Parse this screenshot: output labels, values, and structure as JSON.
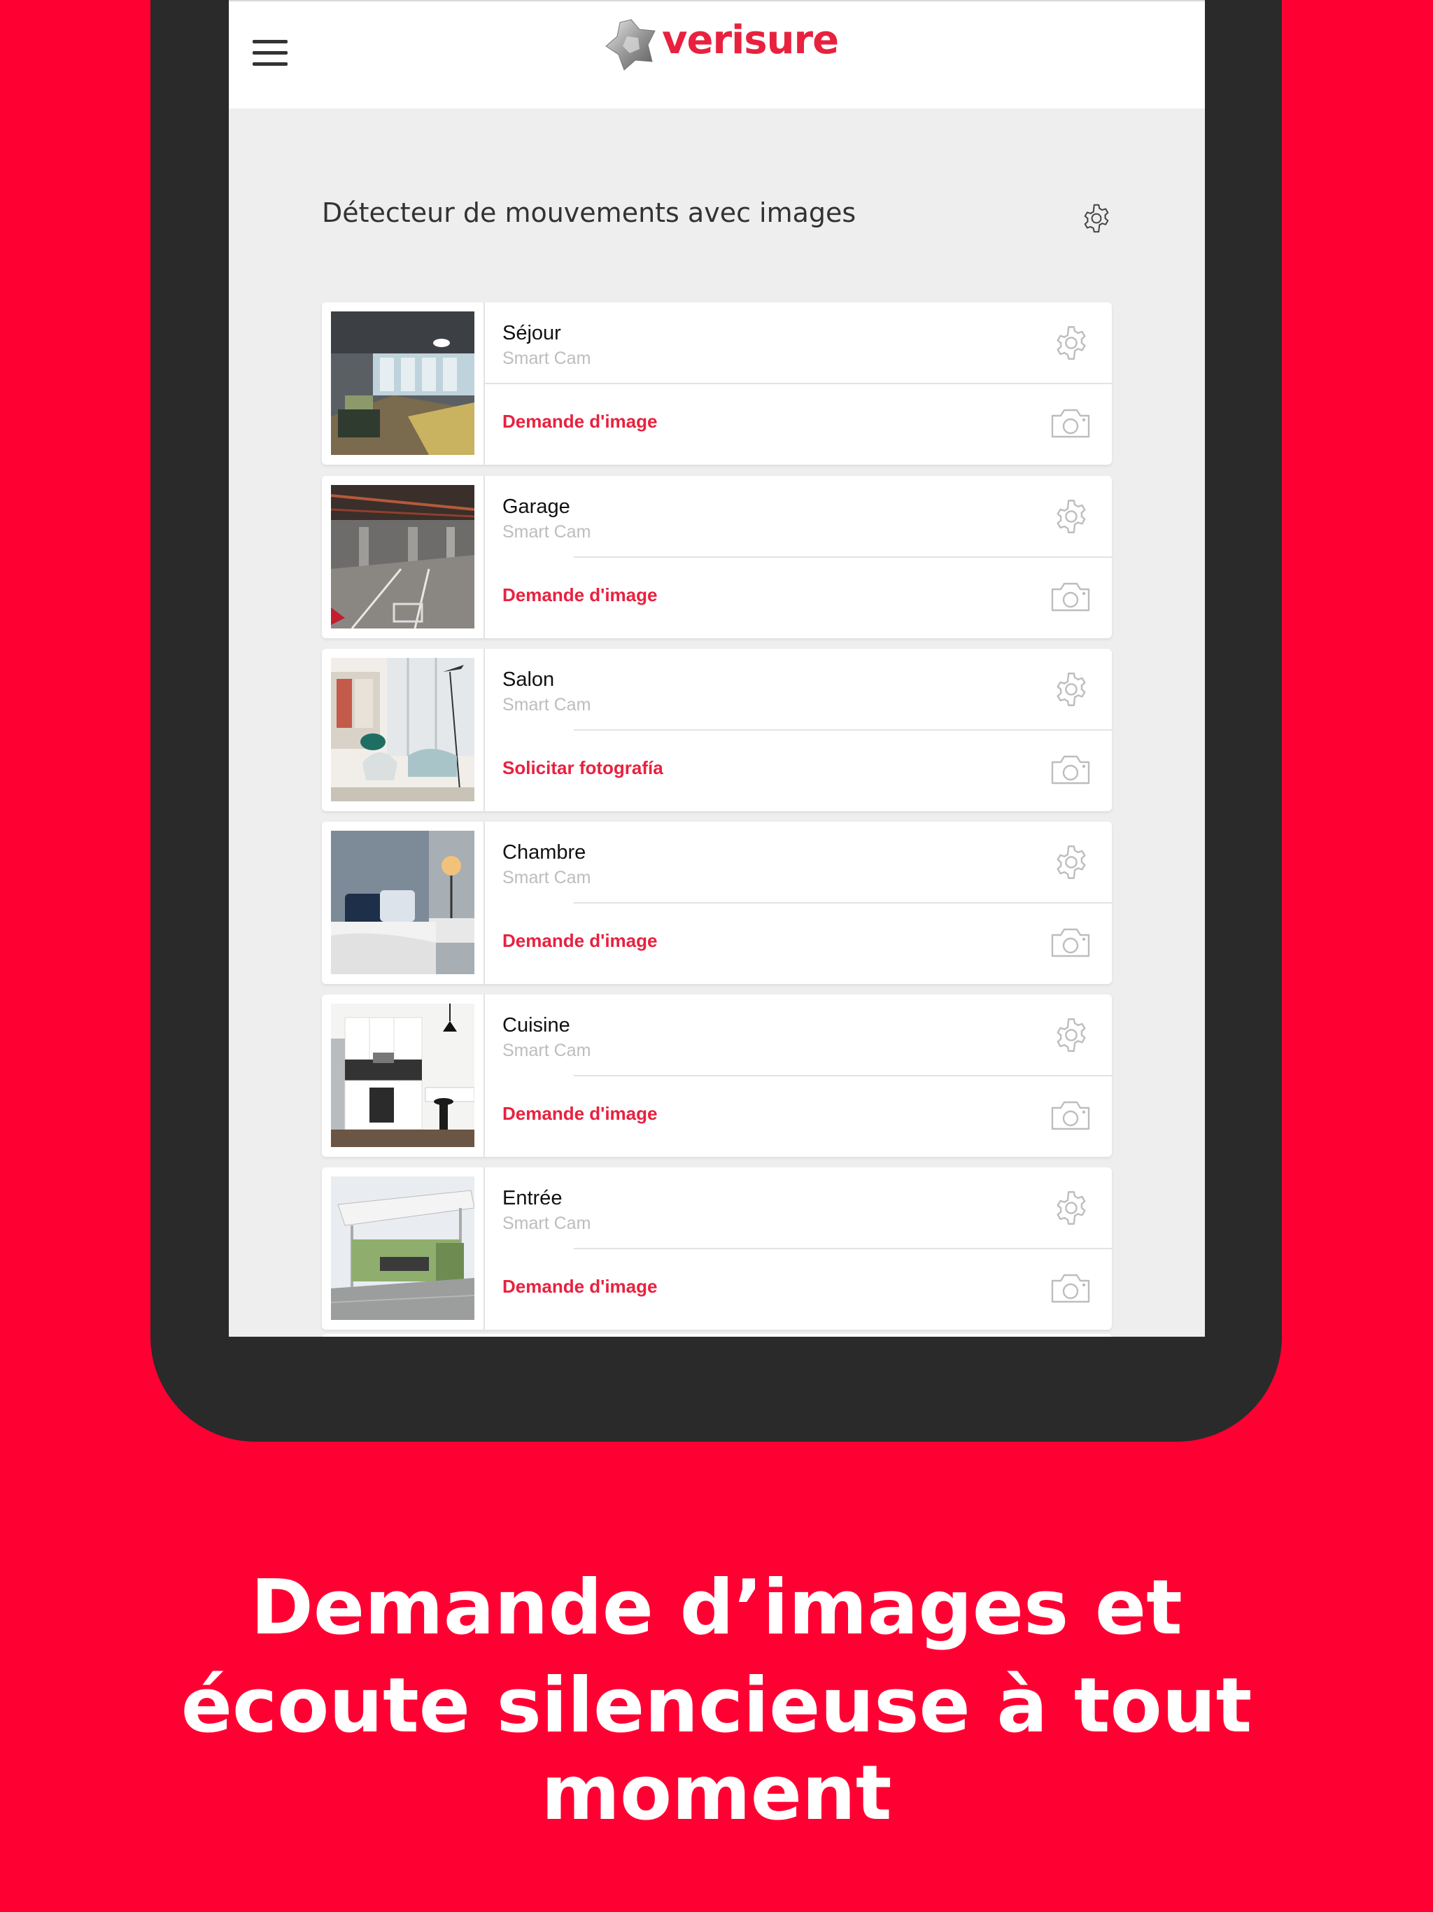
{
  "app": {
    "logo_text": "verisure",
    "brand_color": "#E8213F",
    "background_color": "#FF0033",
    "menu_icon": "hamburger-menu-icon"
  },
  "section": {
    "title": "Détecteur de mouvements avec images",
    "settings_icon": "gear-icon"
  },
  "devices": [
    {
      "name": "Séjour",
      "type": "Smart Cam",
      "action": "Demande d'image"
    },
    {
      "name": "Garage",
      "type": "Smart Cam",
      "action": "Demande d'image"
    },
    {
      "name": "Salon",
      "type": "Smart Cam",
      "action": "Solicitar fotografía"
    },
    {
      "name": "Chambre",
      "type": "Smart Cam",
      "action": "Demande d'image"
    },
    {
      "name": "Cuisine",
      "type": "Smart Cam",
      "action": "Demande d'image"
    },
    {
      "name": "Entrée",
      "type": "Smart Cam",
      "action": "Demande d'image"
    }
  ],
  "caption": {
    "line1": "Demande d’images et",
    "line2": "écoute silencieuse à tout moment"
  }
}
